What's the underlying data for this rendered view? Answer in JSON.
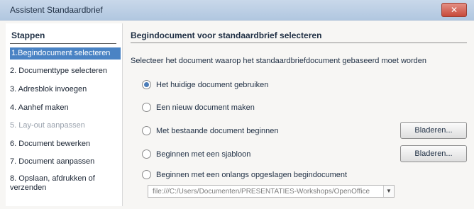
{
  "window": {
    "title": "Assistent Standaardbrief",
    "close_glyph": "✕"
  },
  "sidebar": {
    "header": "Stappen",
    "steps": [
      {
        "label": "1.Begindocument selecteren",
        "state": "active"
      },
      {
        "label": "2. Documenttype selecteren",
        "state": "normal"
      },
      {
        "label": "3. Adresblok invoegen",
        "state": "normal"
      },
      {
        "label": "4. Aanhef maken",
        "state": "normal"
      },
      {
        "label": "5. Lay-out aanpassen",
        "state": "disabled"
      },
      {
        "label": "6. Document bewerken",
        "state": "normal"
      },
      {
        "label": "7. Document aanpassen",
        "state": "normal"
      },
      {
        "label": "8. Opslaan, afdrukken of verzenden",
        "state": "normal"
      }
    ]
  },
  "main": {
    "title": "Begindocument voor standaardbrief selecteren",
    "description": "Selecteer het document waarop het standaardbriefdocument gebaseerd moet worden",
    "options": [
      {
        "label": "Het huidige document gebruiken",
        "checked": true
      },
      {
        "label": "Een nieuw document maken",
        "checked": false
      },
      {
        "label": "Met bestaande document beginnen",
        "checked": false
      },
      {
        "label": "Beginnen met een sjabloon",
        "checked": false
      },
      {
        "label": "Beginnen met een onlangs opgeslagen begindocument",
        "checked": false
      }
    ],
    "browse_label": "Bladeren...",
    "recent_document": "file:///C:/Users/Documenten/PRESENTATIES-Workshops/OpenOffice"
  },
  "colors": {
    "accent": "#4a83c4",
    "titlebar": "#b1c7e0"
  }
}
